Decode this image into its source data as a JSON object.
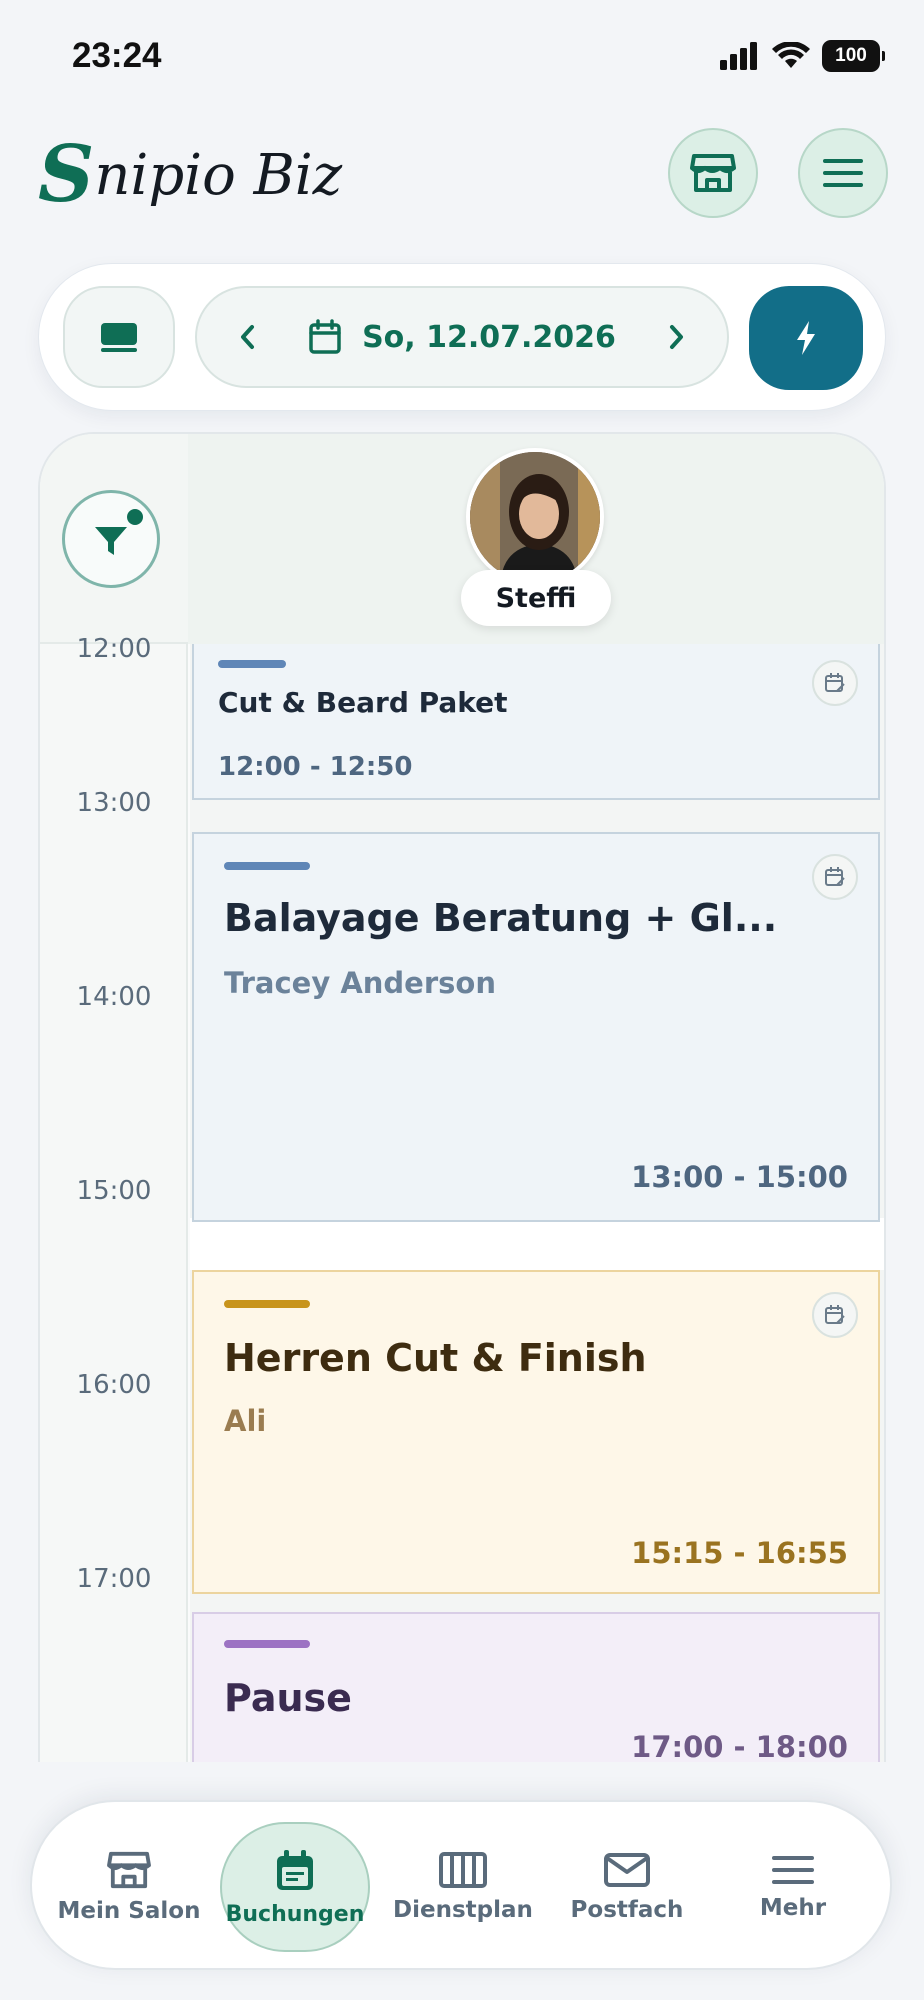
{
  "status_bar": {
    "time": "23:24",
    "battery": "100"
  },
  "header": {
    "brand_initial": "S",
    "brand_rest": "nipio Biz"
  },
  "toolbar": {
    "date_label": "So, 12.07.2026"
  },
  "staff": {
    "name": "Steffi"
  },
  "time_labels": [
    "12:00",
    "13:00",
    "14:00",
    "15:00",
    "16:00",
    "17:00"
  ],
  "events": [
    {
      "title": "Cut & Beard Paket",
      "customer": "",
      "time": "12:00 - 12:50",
      "accent": "#5f86b7"
    },
    {
      "title": "Balayage Beratung + Gl...",
      "customer": "Tracey Anderson",
      "time": "13:00 - 15:00",
      "accent": "#5f86b7"
    },
    {
      "title": "Herren Cut & Finish",
      "customer": "Ali",
      "time": "15:15 - 16:55",
      "accent": "#c8941c"
    },
    {
      "title": "Pause",
      "customer": "",
      "time": "17:00 - 18:00",
      "accent": "#9c72c3"
    }
  ],
  "nav": [
    {
      "label": "Mein Salon",
      "icon": "store-icon"
    },
    {
      "label": "Buchungen",
      "icon": "calendar-icon",
      "active": true
    },
    {
      "label": "Dienstplan",
      "icon": "schedule-grid-icon"
    },
    {
      "label": "Postfach",
      "icon": "mail-icon"
    },
    {
      "label": "Mehr",
      "icon": "menu-icon"
    }
  ],
  "colors": {
    "brand": "#0f6e55",
    "accent_teal": "#126e88",
    "gold": "#c9a227"
  }
}
